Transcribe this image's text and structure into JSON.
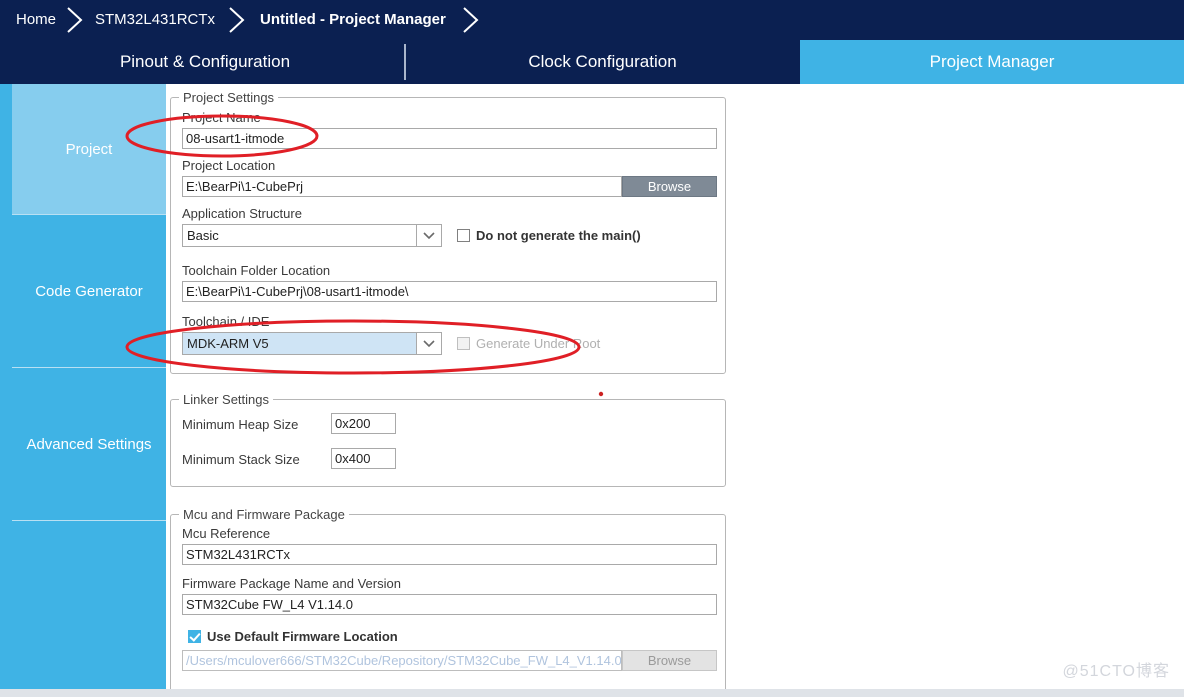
{
  "breadcrumb": {
    "items": [
      {
        "label": "Home",
        "active": false
      },
      {
        "label": "STM32L431RCTx",
        "active": false
      },
      {
        "label": "Untitled - Project Manager",
        "active": true
      }
    ]
  },
  "tabs": [
    {
      "label": "Pinout & Configuration",
      "selected": false
    },
    {
      "label": "Clock Configuration",
      "selected": false
    },
    {
      "label": "Project Manager",
      "selected": true
    }
  ],
  "sidebar": {
    "items": [
      {
        "label": "Project",
        "selected": true
      },
      {
        "label": "Code Generator",
        "selected": false
      },
      {
        "label": "Advanced Settings",
        "selected": false
      },
      {
        "label": "",
        "selected": false
      }
    ]
  },
  "project_settings": {
    "group_title": "Project Settings",
    "project_name_label": "Project Name",
    "project_name_value": "08-usart1-itmode",
    "project_location_label": "Project Location",
    "project_location_value": "E:\\BearPi\\1-CubePrj",
    "project_location_browse": "Browse",
    "application_structure_label": "Application Structure",
    "application_structure_value": "Basic",
    "do_not_generate_main_label": "Do not generate the main()",
    "do_not_generate_main_checked": false,
    "toolchain_folder_label": "Toolchain Folder Location",
    "toolchain_folder_value": "E:\\BearPi\\1-CubePrj\\08-usart1-itmode\\",
    "toolchain_ide_label": "Toolchain / IDE",
    "toolchain_ide_value": "MDK-ARM V5",
    "generate_under_root_label": "Generate Under Root",
    "generate_under_root_checked": false,
    "generate_under_root_disabled": true
  },
  "linker_settings": {
    "group_title": "Linker Settings",
    "heap_label": "Minimum Heap Size",
    "heap_value": "0x200",
    "stack_label": "Minimum Stack Size",
    "stack_value": "0x400"
  },
  "mcu_firmware": {
    "group_title": "Mcu and Firmware Package",
    "mcu_reference_label": "Mcu Reference",
    "mcu_reference_value": "STM32L431RCTx",
    "firmware_package_label": "Firmware Package Name and Version",
    "firmware_package_value": "STM32Cube FW_L4 V1.14.0",
    "use_default_location_label": "Use Default Firmware Location",
    "use_default_location_checked": true,
    "firmware_location_value": "/Users/mculover666/STM32Cube/Repository/STM32Cube_FW_L4_V1.14.0",
    "firmware_browse": "Browse"
  },
  "annotations": {
    "ellipse_color": "#e01f26",
    "dot_color": "#cc2222"
  },
  "watermark": "@51CTO博客",
  "colors": {
    "navy": "#0b2051",
    "accent_blue": "#3fb3e5",
    "sidebar_selected": "#86cdee",
    "field_focus": "#cfe4f5"
  }
}
